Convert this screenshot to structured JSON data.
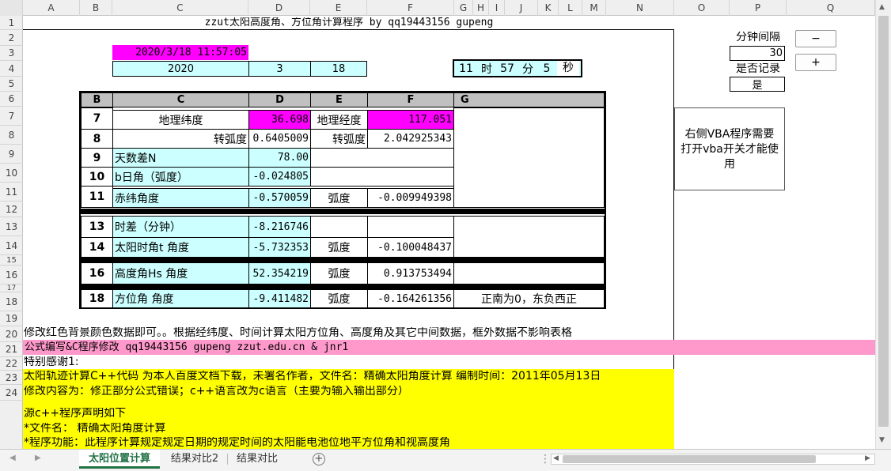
{
  "columns": [
    "A",
    "B",
    "C",
    "D",
    "E",
    "F",
    "G",
    "H",
    "I",
    "J",
    "K",
    "L",
    "M",
    "N",
    "O",
    "P",
    "Q"
  ],
  "rows": [
    "1",
    "2",
    "3",
    "4",
    "5",
    "6",
    "7",
    "8",
    "9",
    "10",
    "11",
    "12",
    "13",
    "14",
    "15",
    "16",
    "17",
    "18",
    "19",
    "20",
    "21",
    "22",
    "23",
    "24"
  ],
  "header": {
    "title": "zzut太阳高度角、方位角计算程序 by qq19443156 gupeng",
    "datetime": "2020/3/18 11:57:05",
    "year": "2020",
    "month": "3",
    "day": "18",
    "hour": "11",
    "hour_unit": "时",
    "minute": "57",
    "minute_unit": "分",
    "second": "5",
    "second_unit": "秒"
  },
  "side": {
    "interval_label": "分钟间隔",
    "interval_value": "30",
    "record_label": "是否记录",
    "record_value": "是",
    "minus": "−",
    "plus": "+",
    "vba_note": "右侧VBA程序需要打开vba开关才能使用"
  },
  "table": {
    "headers": [
      "B",
      "C",
      "D",
      "E",
      "F",
      "G"
    ],
    "r7": {
      "num": "7",
      "label": "地理纬度",
      "value": "36.698",
      "label2": "地理经度",
      "value2": "117.051"
    },
    "r8": {
      "num": "8",
      "label": "转弧度",
      "value": "0.6405009",
      "label2": "转弧度",
      "value2": "2.042925343"
    },
    "r9": {
      "num": "9",
      "label": "天数差N",
      "value": "78.00"
    },
    "r10": {
      "num": "10",
      "label": "b日角（弧度）",
      "value": "-0.024805"
    },
    "r11": {
      "num": "11",
      "label": "赤纬角度",
      "value": "-0.570059",
      "label2": "弧度",
      "value2": "-0.009949398"
    },
    "r13": {
      "num": "13",
      "label": "时差（分钟）",
      "value": "-8.216746"
    },
    "r14": {
      "num": "14",
      "label": "太阳时角t 角度",
      "value": "-5.732353",
      "label2": "弧度",
      "value2": "-0.100048437"
    },
    "r16": {
      "num": "16",
      "label": "高度角Hs  角度",
      "value": "52.354219",
      "label2": "弧度",
      "value2": "0.913753494"
    },
    "r18": {
      "num": "18",
      "label": "方位角    角度",
      "value": "-9.411482",
      "label2": "弧度",
      "value2": "-0.164261356",
      "note": "正南为0，东负西正"
    }
  },
  "notes": {
    "r20": "修改红色背景颜色数据即可。。根据经纬度、时间计算太阳方位角、高度角及其它中间数据，框外数据不影响表格",
    "r21": "公式编写&C程序修改 qq19443156 gupeng zzut.edu.cn & jnr1",
    "r22": "特别感谢1:",
    "r23": "太阳轨迹计算C++代码 为本人百度文档下载，未署名作者，文件名：精确太阳角度计算 编制时间：2011年05月13日",
    "r24": "修改内容为：修正部分公式错误；c++语言改为c语言（主要为输入输出部分）",
    "src1": "源c++程序声明如下",
    "src2": "*文件名：   精确太阳角度计算",
    "src3": "*程序功能：此程序计算规定规定日期的规定时间的太阳能电池位地平方位角和视高度角"
  },
  "sheets": {
    "active": "太阳位置计算",
    "tab2": "结果对比2",
    "tab3": "结果对比",
    "add": "+"
  },
  "colors": {
    "magenta": "#ff00ff",
    "cyan": "#ccffff",
    "pink": "#ff99cc",
    "yellow": "#ffff00",
    "tab_green": "#217346"
  }
}
